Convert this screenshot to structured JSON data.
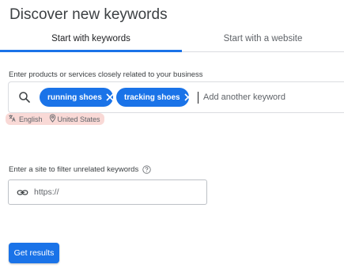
{
  "page": {
    "title": "Discover new keywords"
  },
  "tabs": [
    {
      "label": "Start with keywords",
      "active": true
    },
    {
      "label": "Start with a website",
      "active": false
    }
  ],
  "keywords": {
    "label": "Enter products or services closely related to your business",
    "chips": [
      "running shoes",
      "tracking shoes"
    ],
    "placeholder": "Add another keyword",
    "search_icon": "search-icon"
  },
  "locale": {
    "language": "English",
    "location": "United States",
    "highlight_color": "#f9d9d6"
  },
  "filter": {
    "label": "Enter a site to filter unrelated keywords",
    "placeholder": "https://",
    "icon": "link-icon",
    "help_icon": "help-icon"
  },
  "actions": {
    "get_results_label": "Get results"
  },
  "colors": {
    "accent": "#1a73e8",
    "text": "#202124",
    "muted": "#5f6368",
    "border": "#dadce0"
  }
}
